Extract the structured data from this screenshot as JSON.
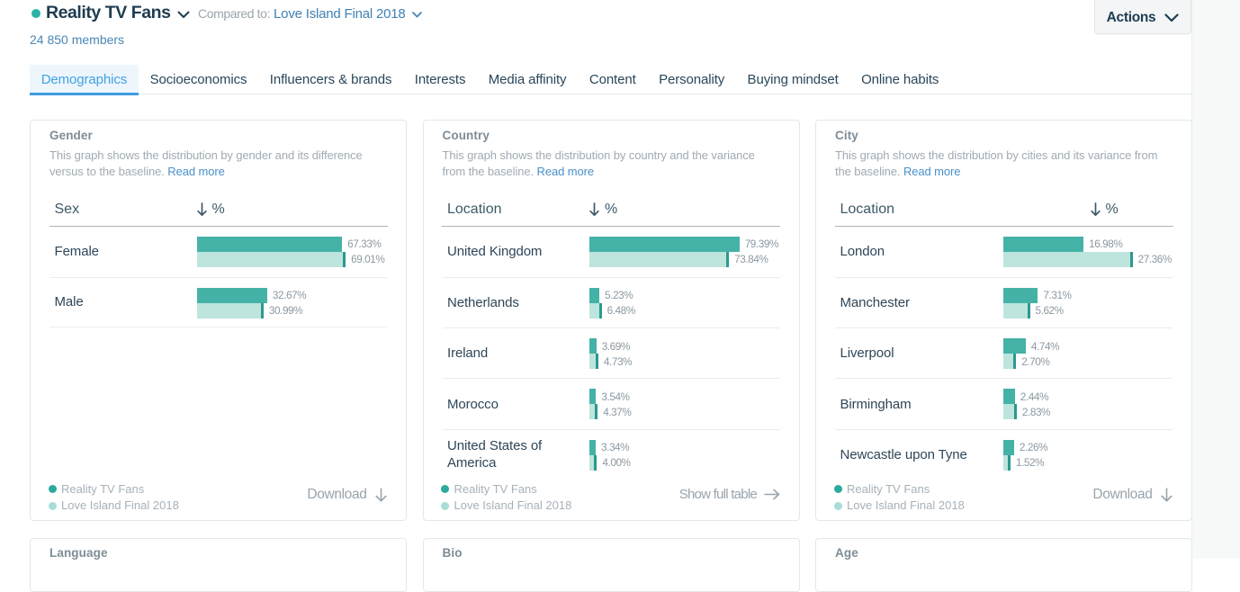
{
  "header": {
    "audience_name": "Reality TV Fans",
    "members": "24 850 members",
    "compared_label": "Compared to:",
    "compared_value": "Love Island Final 2018",
    "actions_label": "Actions"
  },
  "tabs": [
    {
      "label": "Demographics",
      "active": true
    },
    {
      "label": "Socioeconomics",
      "active": false
    },
    {
      "label": "Influencers & brands",
      "active": false
    },
    {
      "label": "Interests",
      "active": false
    },
    {
      "label": "Media affinity",
      "active": false
    },
    {
      "label": "Content",
      "active": false
    },
    {
      "label": "Personality",
      "active": false
    },
    {
      "label": "Buying mindset",
      "active": false
    },
    {
      "label": "Online habits",
      "active": false
    }
  ],
  "colors": {
    "audience_dot": "#2cb3a6",
    "primary_series": "#45b2a7",
    "baseline_series": "#bee4de",
    "baseline_cap": "#2a9a8e",
    "legend_primary_dot": "#2ca99c",
    "legend_baseline_dot": "#a7ddd7",
    "active_tab": "#3e9de0",
    "link_blue": "#4a90c8"
  },
  "legend": [
    {
      "label": "Reality TV Fans",
      "series": "primary"
    },
    {
      "label": "Love Island Final 2018",
      "series": "baseline"
    }
  ],
  "cards": [
    {
      "title": "Gender",
      "description_lines": [
        "This graph shows the distribution by gender and its difference",
        "versus to the baseline."
      ],
      "read_more": "Read more",
      "col1_header": "Sex",
      "col2_header": "%",
      "axis_max": 70,
      "footer_label": "Download",
      "footer_icon": "download",
      "last_divider": true,
      "wide_labels": false,
      "rows": [
        {
          "label": "Female",
          "primary": 67.33,
          "baseline": 69.01
        },
        {
          "label": "Male",
          "primary": 32.67,
          "baseline": 30.99
        }
      ]
    },
    {
      "title": "Country",
      "description_lines": [
        "This graph shows the distribution by country and the variance",
        "from the baseline."
      ],
      "read_more": "Read more",
      "col1_header": "Location",
      "col2_header": "%",
      "axis_max": 80,
      "footer_label": "Show full table",
      "footer_icon": "arrow-right",
      "last_divider": false,
      "wide_labels": false,
      "rows": [
        {
          "label": "United Kingdom",
          "primary": 79.39,
          "baseline": 73.84
        },
        {
          "label": "Netherlands",
          "primary": 5.23,
          "baseline": 6.48
        },
        {
          "label": "Ireland",
          "primary": 3.69,
          "baseline": 4.73
        },
        {
          "label": "Morocco",
          "primary": 3.54,
          "baseline": 4.37
        },
        {
          "label": "United States of America",
          "primary": 3.34,
          "baseline": 4.0
        }
      ]
    },
    {
      "title": "City",
      "description_lines": [
        "This graph shows the distribution by cities and its variance from",
        "the baseline."
      ],
      "read_more": "Read more",
      "col1_header": "Location",
      "col2_header": "%",
      "axis_max": 32,
      "footer_label": "Download",
      "footer_icon": "download",
      "last_divider": false,
      "wide_labels": true,
      "rows": [
        {
          "label": "London",
          "primary": 16.98,
          "baseline": 27.36
        },
        {
          "label": "Manchester",
          "primary": 7.31,
          "baseline": 5.62
        },
        {
          "label": "Liverpool",
          "primary": 4.74,
          "baseline": 2.7
        },
        {
          "label": "Birmingham",
          "primary": 2.44,
          "baseline": 2.83
        },
        {
          "label": "Newcastle upon Tyne",
          "primary": 2.26,
          "baseline": 1.52
        }
      ]
    }
  ],
  "bottom_cards": [
    {
      "title": "Language"
    },
    {
      "title": "Bio"
    },
    {
      "title": "Age"
    }
  ],
  "chart_data": [
    {
      "type": "bar",
      "title": "Gender",
      "orientation": "horizontal",
      "categories": [
        "Female",
        "Male"
      ],
      "series": [
        {
          "name": "Reality TV Fans",
          "values": [
            67.33,
            32.67
          ]
        },
        {
          "name": "Love Island Final 2018",
          "values": [
            69.01,
            30.99
          ]
        }
      ],
      "xlabel": "%",
      "ylabel": "Sex",
      "xlim": [
        0,
        70
      ],
      "legend_position": "bottom-left"
    },
    {
      "type": "bar",
      "title": "Country",
      "orientation": "horizontal",
      "categories": [
        "United Kingdom",
        "Netherlands",
        "Ireland",
        "Morocco",
        "United States of America"
      ],
      "series": [
        {
          "name": "Reality TV Fans",
          "values": [
            79.39,
            5.23,
            3.69,
            3.54,
            3.34
          ]
        },
        {
          "name": "Love Island Final 2018",
          "values": [
            73.84,
            6.48,
            4.73,
            4.37,
            4.0
          ]
        }
      ],
      "xlabel": "%",
      "ylabel": "Location",
      "xlim": [
        0,
        80
      ],
      "legend_position": "bottom-left"
    },
    {
      "type": "bar",
      "title": "City",
      "orientation": "horizontal",
      "categories": [
        "London",
        "Manchester",
        "Liverpool",
        "Birmingham",
        "Newcastle upon Tyne"
      ],
      "series": [
        {
          "name": "Reality TV Fans",
          "values": [
            16.98,
            7.31,
            4.74,
            2.44,
            2.26
          ]
        },
        {
          "name": "Love Island Final 2018",
          "values": [
            27.36,
            5.62,
            2.7,
            2.83,
            1.52
          ]
        }
      ],
      "xlabel": "%",
      "ylabel": "Location",
      "xlim": [
        0,
        32
      ],
      "legend_position": "bottom-left"
    }
  ]
}
